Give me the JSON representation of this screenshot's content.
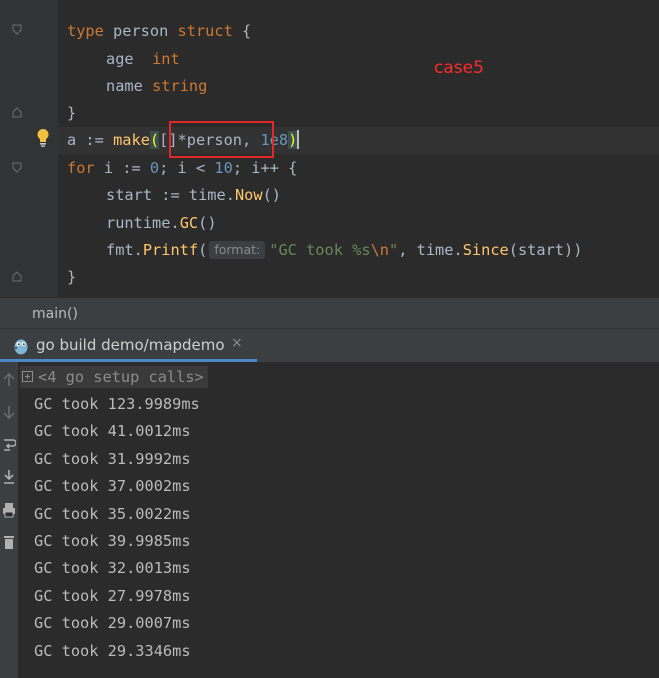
{
  "editor": {
    "code": {
      "type_kw": "type",
      "person_name": " person ",
      "struct_kw": "struct",
      "open_brace": " {",
      "age_field": "age  ",
      "int_type": "int",
      "name_field": "name ",
      "string_type": "string",
      "close_brace": "}",
      "a_assign": "a := ",
      "make_fn": "make",
      "open_paren": "(",
      "slice_type": "[]*person, ",
      "size_literal": "1e8",
      "close_paren": ")",
      "for_kw": "for",
      "loop_init": " i := ",
      "zero": "0",
      "loop_cond": "; i < ",
      "ten": "10",
      "loop_post": "; i++ {",
      "start_assign": "start := ",
      "time_pkg": "time.",
      "now_fn": "Now",
      "now_call": "()",
      "runtime_pkg": "runtime.",
      "gc_fn": "GC",
      "gc_call": "()",
      "fmt_pkg": "fmt.",
      "printf_fn": "Printf",
      "printf_open": "(",
      "param_hint": "format:",
      "format_str_a": "\"GC took %s",
      "format_escape": "\\n",
      "format_str_b": "\"",
      "printf_sep": ", ",
      "since_pkg": "time.",
      "since_fn": "Since",
      "since_args": "(start))",
      "loop_close": "}"
    },
    "annotation": "case5"
  },
  "breadcrumb": {
    "label": "main()"
  },
  "run": {
    "tab_label": "go build demo/mapdemo",
    "tab_close": "×",
    "setup_calls": "<4 go setup calls>",
    "output": [
      "GC took 123.9989ms",
      "GC took 41.0012ms",
      "GC took 31.9992ms",
      "GC took 37.0002ms",
      "GC took 35.0022ms",
      "GC took 39.9985ms",
      "GC took 32.0013ms",
      "GC took 27.9978ms",
      "GC took 29.0007ms",
      "GC took 29.3346ms"
    ]
  },
  "colors": {
    "background": "#2b2b2b",
    "keyword": "#cc7832",
    "number": "#6897bb",
    "function": "#ffc66d",
    "string": "#6a8759",
    "annotation_red": "#ff2a2a",
    "tab_underline": "#4a88c7"
  }
}
